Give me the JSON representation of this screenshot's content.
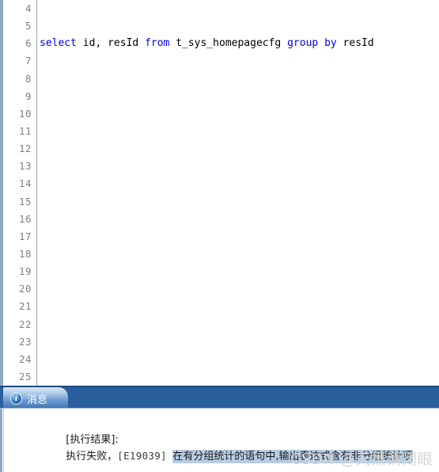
{
  "editor": {
    "line_numbers": [
      4,
      5,
      6,
      7,
      8,
      9,
      10,
      11,
      12,
      13,
      14,
      15,
      16,
      17,
      18,
      19,
      20,
      21,
      22,
      23,
      24,
      25
    ],
    "sql_line_number": 6,
    "sql_tokens": [
      {
        "text": "select",
        "type": "keyword"
      },
      {
        "text": " id, resId ",
        "type": "plain"
      },
      {
        "text": "from",
        "type": "keyword"
      },
      {
        "text": " t_sys_homepagecfg ",
        "type": "plain"
      },
      {
        "text": "group",
        "type": "keyword"
      },
      {
        "text": " ",
        "type": "plain"
      },
      {
        "text": "by",
        "type": "keyword"
      },
      {
        "text": " resId",
        "type": "plain"
      }
    ],
    "sql_text": "select id, resId from t_sys_homepagecfg group by resId",
    "keyword_color": "#0000ee",
    "plain_color": "#000000"
  },
  "message_panel": {
    "tab": {
      "label": "消息",
      "icon": "info-icon"
    },
    "lines": [
      {
        "label": "[执行结果]:"
      },
      {
        "prefix": "执行失败，",
        "error_code": "[E19039]",
        "highlighted": "在有分组统计的语句中,输出表达式含有非分组统计项"
      }
    ],
    "highlight_color": "#b8cde4",
    "tabbar_color": "#2a5f9e"
  },
  "watermark": {
    "text": "CSDN @天黑请闭眼"
  }
}
